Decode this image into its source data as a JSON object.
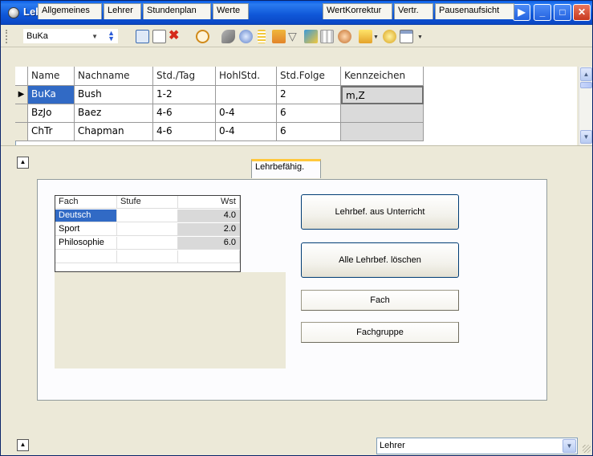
{
  "window": {
    "title": "Lehrer / Lehrer"
  },
  "toolbar": {
    "selector_value": "BuKa",
    "icons": [
      "grid-icon",
      "new-record-icon",
      "delete-icon",
      "clock-icon",
      "tools-icon",
      "settings-icon",
      "list-icon",
      "print-icon",
      "filter-icon",
      "sort-icon",
      "table-icon",
      "users-icon",
      "export-icon",
      "gear-icon",
      "calendar-icon"
    ]
  },
  "grid": {
    "columns": [
      "Name",
      "Nachname",
      "Std./Tag",
      "HohlStd.",
      "Std.Folge",
      "Kennzeichen"
    ],
    "rows": [
      {
        "name": "BuKa",
        "nachname": "Bush",
        "std_tag": "1-2",
        "hohlstd": "",
        "std_folge": "2",
        "kennzeichen": "m,Z"
      },
      {
        "name": "BzJo",
        "nachname": "Baez",
        "std_tag": "4-6",
        "hohlstd": "0-4",
        "std_folge": "6",
        "kennzeichen": ""
      },
      {
        "name": "ChTr",
        "nachname": "Chapman",
        "std_tag": "4-6",
        "hohlstd": "0-4",
        "std_folge": "6",
        "kennzeichen": ""
      }
    ],
    "selected_row": 0
  },
  "tabs": [
    "Allgemeines",
    "Lehrer",
    "Stundenplan",
    "Werte",
    "Lehrbefähig.",
    "WertKorrektur",
    "Vertr.",
    "Pausenaufsicht"
  ],
  "active_tab": "Lehrbefähig.",
  "lehrbef_table": {
    "columns": [
      "Fach",
      "Stufe",
      "Wst"
    ],
    "rows": [
      {
        "fach": "Deutsch",
        "stufe": "",
        "wst": "4.0"
      },
      {
        "fach": "Sport",
        "stufe": "",
        "wst": "2.0"
      },
      {
        "fach": "Philosophie",
        "stufe": "",
        "wst": "6.0"
      }
    ]
  },
  "buttons": {
    "lehrbef_aus_unterricht": "Lehrbef. aus Unterricht",
    "alle_loeschen": "Alle Lehrbef. löschen",
    "fach": "Fach",
    "fachgruppe": "Fachgruppe"
  },
  "bottom": {
    "select_value": "Lehrer"
  },
  "colors": {
    "title_bar": "#0a5ee8",
    "selection": "#316ac5",
    "active_tab_accent": "#ffc83c",
    "window_bg": "#ece9d8"
  }
}
